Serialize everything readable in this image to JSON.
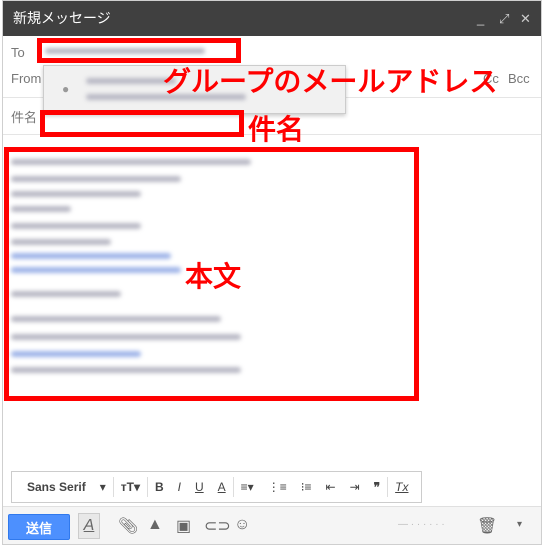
{
  "window": {
    "title": "新規メッセージ",
    "minimize": "_",
    "expand": "⤢",
    "close": "✕"
  },
  "fields": {
    "to_label": "To",
    "from_label": "From",
    "subject_label": "件名",
    "cc": "Cc",
    "bcc": "Bcc"
  },
  "annotations": {
    "group_address": "グループのメールアドレス",
    "subject": "件名",
    "body": "本文",
    "color": "#ff0000"
  },
  "format_toolbar": {
    "font": "Sans Serif",
    "items": [
      "size",
      "bold",
      "italic",
      "underline",
      "text-color",
      "align",
      "numbered-list",
      "bulleted-list",
      "indent-less",
      "indent-more",
      "quote",
      "remove-formatting"
    ],
    "bold": "B",
    "italic": "I",
    "underline": "U",
    "color": "A",
    "quote": "❞",
    "clear": "Tx"
  },
  "bottom_bar": {
    "send": "送信",
    "send_color": "#4d90fe"
  }
}
